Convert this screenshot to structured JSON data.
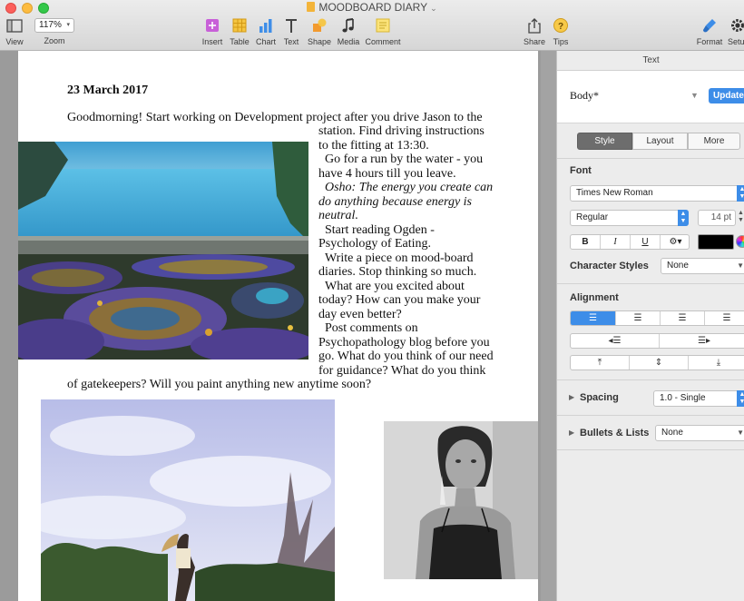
{
  "window": {
    "title": "MOODBOARD DIARY"
  },
  "toolbar": {
    "view_label": "View",
    "zoom_value": "117%",
    "zoom_label": "Zoom",
    "insert_label": "Insert",
    "table_label": "Table",
    "chart_label": "Chart",
    "text_label": "Text",
    "shape_label": "Shape",
    "media_label": "Media",
    "comment_label": "Comment",
    "share_label": "Share",
    "tips_label": "Tips",
    "format_label": "Format",
    "setup_label": "Setu",
    "colors": {
      "close": "#fc605c",
      "minimize": "#fdbc40",
      "zoom": "#34c84a"
    }
  },
  "document": {
    "date": "23 March 2017",
    "lines": [
      "Goodmorning! Start working on Development project after you drive Jason to the",
      "station. Find driving instructions",
      "to the fitting at 13:30.",
      "Go for a run by the water - you",
      "have 4 hours till you leave.",
      "Osho: The energy you create can",
      "do anything because energy is",
      "neutral.",
      "Start reading Ogden -",
      "Psychology of Eating.",
      "Write a piece on mood-board",
      "diaries. Stop thinking so much.",
      "What are you excited about",
      "today? How can you make your",
      "day even better?",
      "Post comments on",
      "Psychopathology blog before you",
      "go. What do you think of our need",
      "for guidance? What do you think",
      "of gatekeepers? Will you paint anything new anytime soon?"
    ]
  },
  "sidebar": {
    "header": "Text",
    "paragraph_style": "Body*",
    "update_label": "Update",
    "tabs": [
      "Style",
      "Layout",
      "More"
    ],
    "font_label": "Font",
    "font_family": "Times New Roman",
    "font_typeface": "Regular",
    "font_size": "14 pt",
    "bold_label": "B",
    "italic_label": "I",
    "underline_label": "U",
    "text_color": "#000000",
    "char_styles_label": "Character Styles",
    "char_styles_value": "None",
    "alignment_label": "Alignment",
    "spacing_label": "Spacing",
    "spacing_value": "1.0 - Single",
    "bullets_label": "Bullets & Lists",
    "bullets_value": "None",
    "accent": "#3d8de8"
  }
}
